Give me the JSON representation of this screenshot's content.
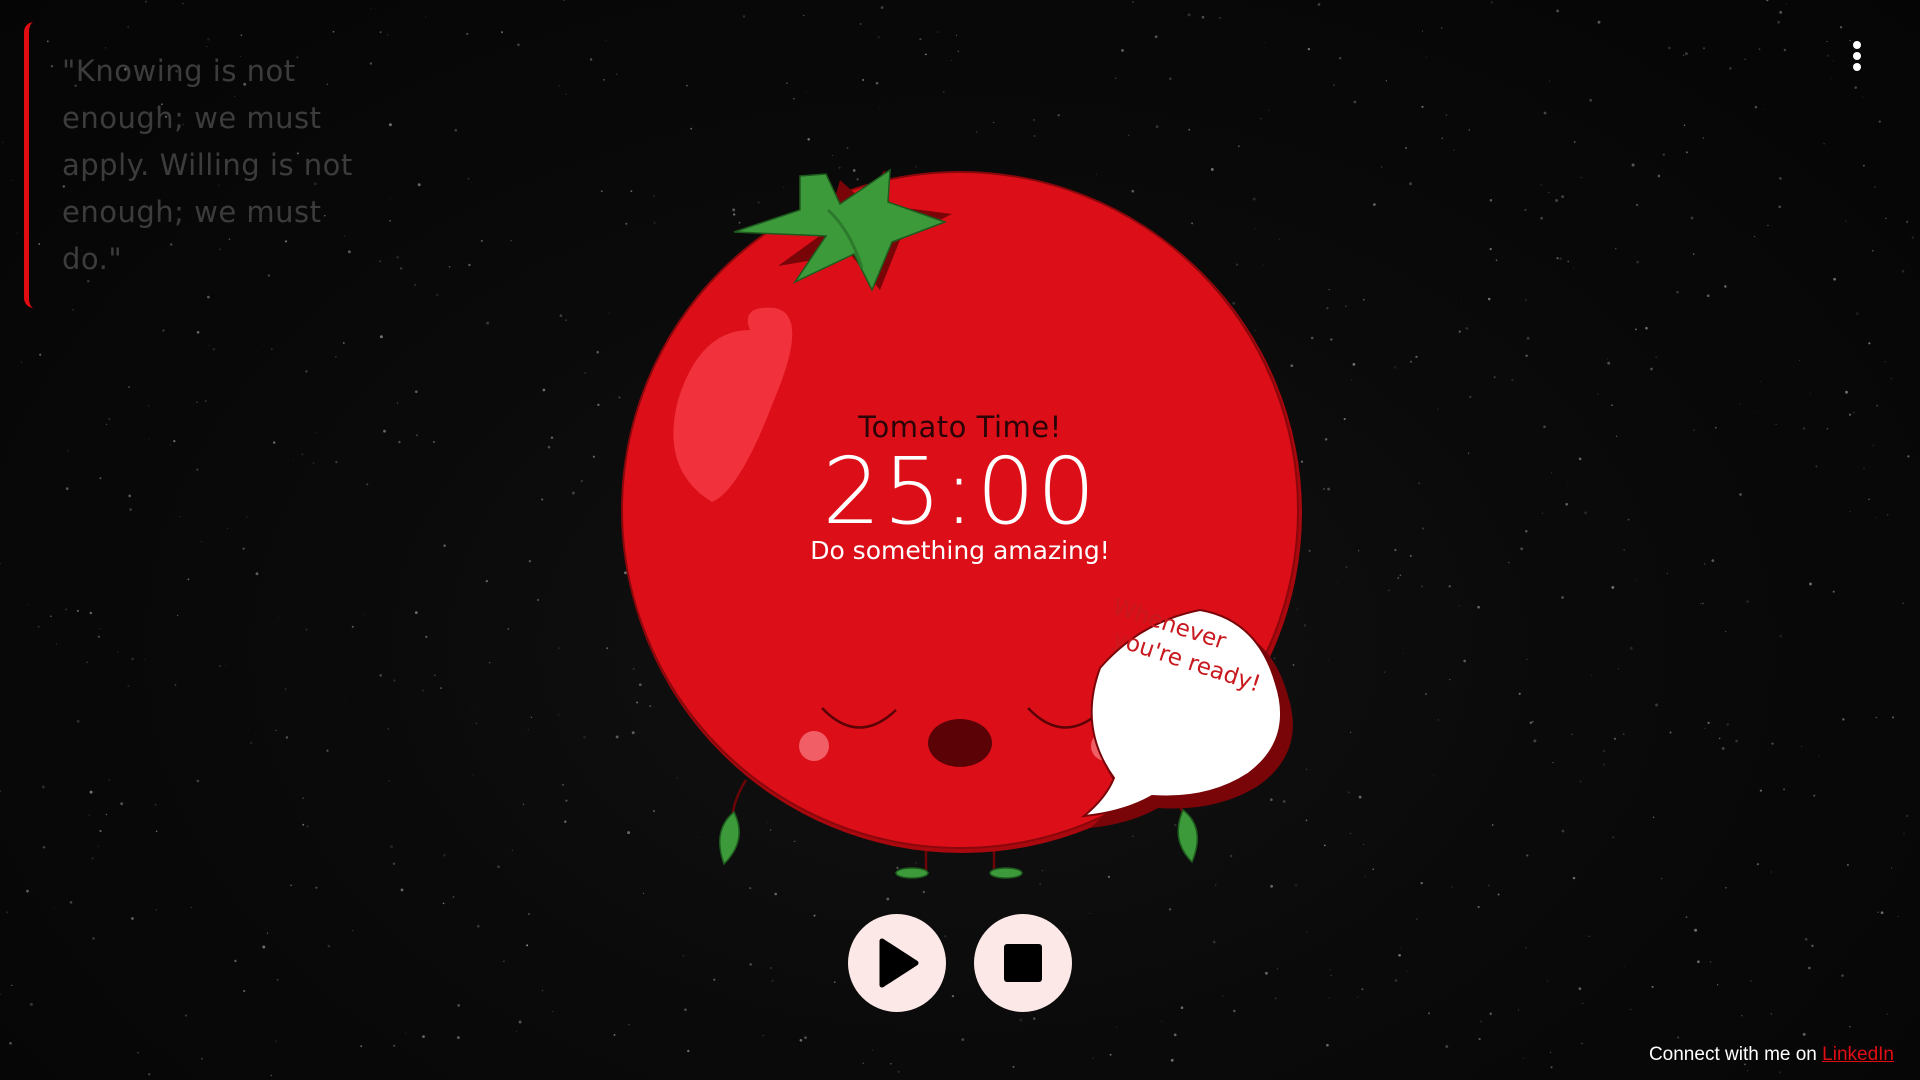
{
  "quote": {
    "text": "\"Knowing is not enough; we must apply. Willing is not enough; we must do.\""
  },
  "menu": {
    "icon": "kebab-menu-icon"
  },
  "timer": {
    "title": "Tomato Time!",
    "value": "25:00",
    "subtitle": "Do something amazing!"
  },
  "speech_bubble": {
    "line1": "Whenever",
    "line2": "you're ready!"
  },
  "controls": {
    "play_icon": "play-icon",
    "stop_icon": "stop-icon"
  },
  "footer": {
    "text": "Connect with me on ",
    "link_label": "LinkedIn"
  },
  "colors": {
    "tomato": "#dc0f18",
    "accent": "#e10c12",
    "button_bg": "#fde8e8",
    "background": "#0a0a0a"
  }
}
